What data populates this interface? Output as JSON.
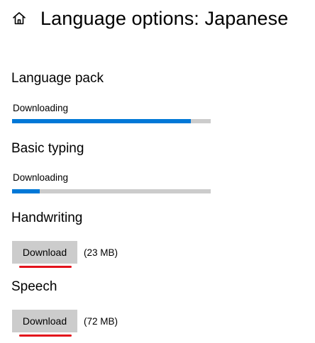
{
  "header": {
    "title": "Language options: Japanese",
    "home_icon": "home-icon"
  },
  "sections": {
    "language_pack": {
      "title": "Language pack",
      "status": "Downloading",
      "progress": 0.9
    },
    "basic_typing": {
      "title": "Basic typing",
      "status": "Downloading",
      "progress": 0.14
    },
    "handwriting": {
      "title": "Handwriting",
      "button_label": "Download",
      "size": "(23 MB)"
    },
    "speech": {
      "title": "Speech",
      "button_label": "Download",
      "size": "(72 MB)"
    }
  },
  "colors": {
    "accent": "#0078d7",
    "track": "#cccccc",
    "button_bg": "#cccccc",
    "annotation_underline": "#e3121b"
  }
}
